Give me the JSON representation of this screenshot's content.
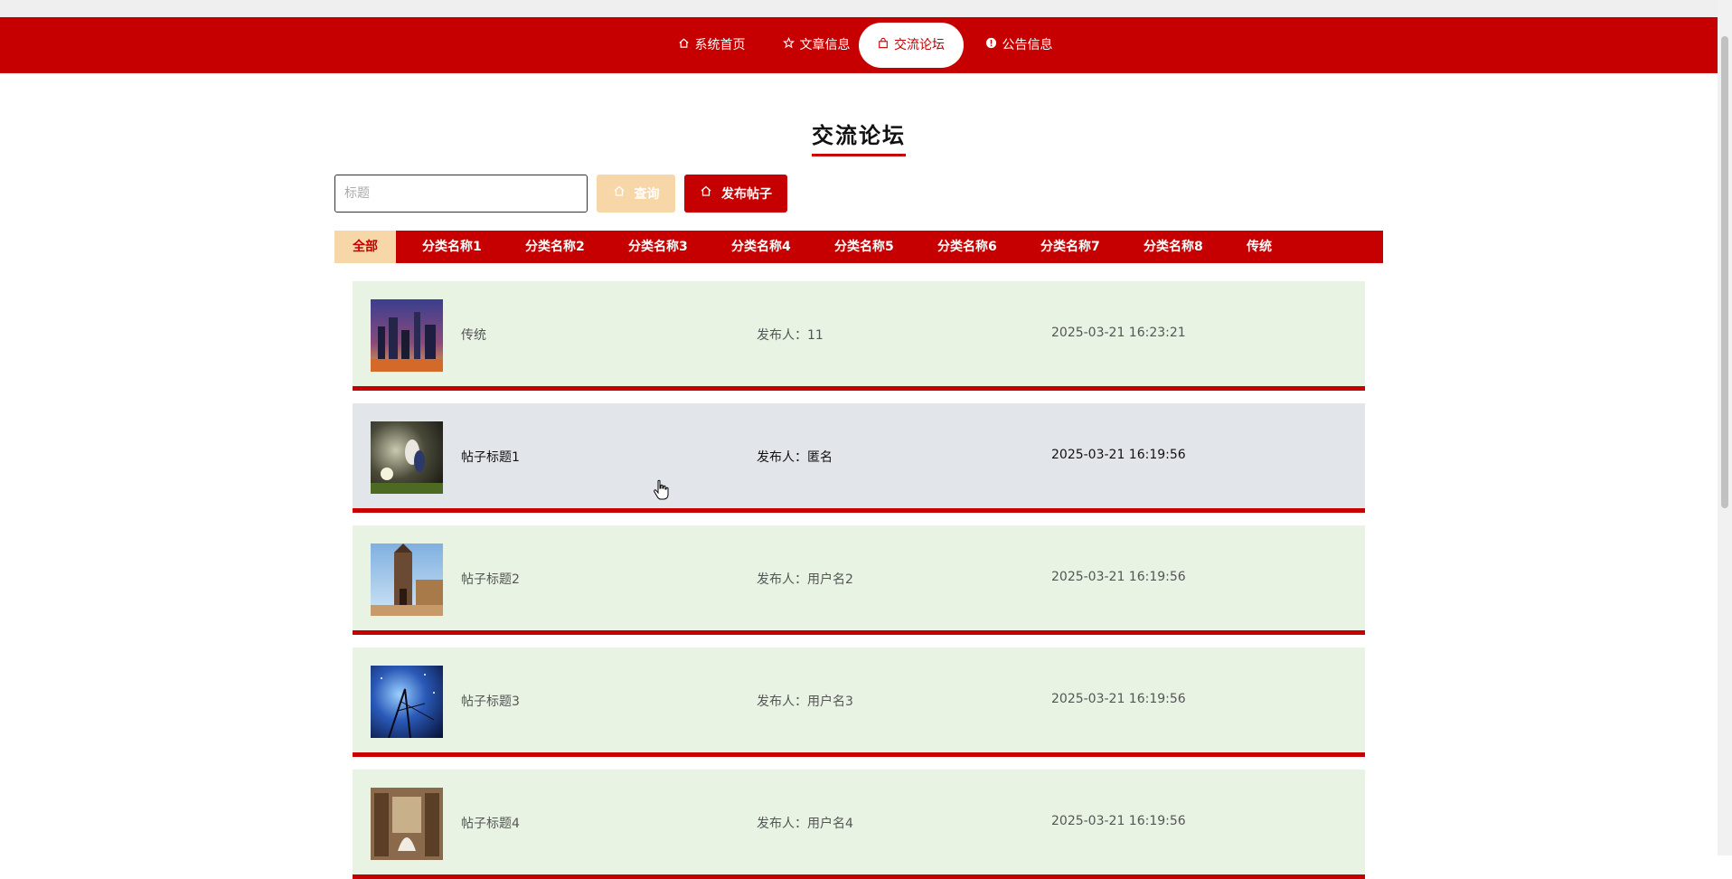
{
  "nav": {
    "items": [
      {
        "label": "系统首页",
        "icon": "home-icon"
      },
      {
        "label": "文章信息",
        "icon": "star-icon"
      },
      {
        "label": "交流论坛",
        "icon": "bag-icon",
        "active": true
      },
      {
        "label": "公告信息",
        "icon": "info-icon"
      }
    ]
  },
  "page": {
    "title": "交流论坛"
  },
  "search": {
    "placeholder": "标题",
    "value": ""
  },
  "buttons": {
    "query": "查询",
    "post": "发布帖子"
  },
  "categories": [
    "全部",
    "分类名称1",
    "分类名称2",
    "分类名称3",
    "分类名称4",
    "分类名称5",
    "分类名称6",
    "分类名称7",
    "分类名称8",
    "传统"
  ],
  "posts": [
    {
      "title": "传统",
      "author": "发布人：11",
      "time": "2025-03-21 16:23:21"
    },
    {
      "title": "帖子标题1",
      "author": "发布人：匿名",
      "time": "2025-03-21 16:19:56"
    },
    {
      "title": "帖子标题2",
      "author": "发布人：用户名2",
      "time": "2025-03-21 16:19:56"
    },
    {
      "title": "帖子标题3",
      "author": "发布人：用户名3",
      "time": "2025-03-21 16:19:56"
    },
    {
      "title": "帖子标题4",
      "author": "发布人：用户名4",
      "time": "2025-03-21 16:19:56"
    }
  ],
  "colors": {
    "primary": "#c60000",
    "accent": "#f7d6a8",
    "row_bg": "#e8f3e4",
    "row_hover": "#e2e6ea"
  }
}
